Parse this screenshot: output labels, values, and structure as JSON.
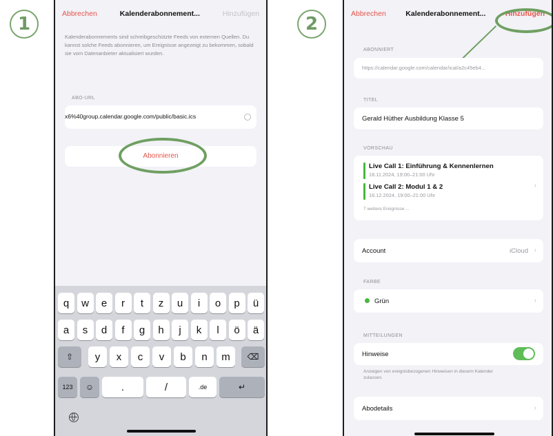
{
  "steps": {
    "one": "1",
    "two": "2"
  },
  "colors": {
    "accent": "#e5544b",
    "annotation": "#6f9f61",
    "toggle_on": "#5fbd58",
    "calendar_green": "#46b83f"
  },
  "screen1": {
    "nav": {
      "cancel": "Abbrechen",
      "title": "Kalenderabonnement...",
      "add": "Hinzufügen"
    },
    "description": "Kalenderabonnements sind schreibgeschützte Feeds von externen Quellen. Du kannst solche Feeds abonnieren, um Ereignisse angezeigt zu bekommen, sobald sie vom Datenanbieter aktualisiert wurden.",
    "url_label": "ABO-URL",
    "url_value": "x6%40group.calendar.google.com/public/basic.ics",
    "clear_icon": "clear-circle-icon",
    "subscribe_button": "Abonnieren",
    "keyboard": {
      "row1": [
        "q",
        "w",
        "e",
        "r",
        "t",
        "z",
        "u",
        "i",
        "o",
        "p",
        "ü"
      ],
      "row2": [
        "a",
        "s",
        "d",
        "f",
        "g",
        "h",
        "j",
        "k",
        "l",
        "ö",
        "ä"
      ],
      "row3": [
        "y",
        "x",
        "c",
        "v",
        "b",
        "n",
        "m"
      ],
      "numbers_key": "123",
      "dot_key": ".",
      "slash_key": "/",
      "de_key": ".de",
      "shift_icon": "shift-icon",
      "delete_icon": "backspace-icon",
      "emoji_icon": "emoji-icon",
      "return_icon": "return-icon",
      "globe_icon": "globe-icon"
    }
  },
  "screen2": {
    "nav": {
      "cancel": "Abbrechen",
      "title": "Kalenderabonnement...",
      "add": "Hinzufügen"
    },
    "subscribed_label": "ABONNIERT",
    "subscribed_url": "https://calendar.google.com/calendar/ical/a2c45eb4...",
    "title_label": "TITEL",
    "title_value": "Gerald Hüther Ausbildung Klasse 5",
    "preview_label": "VORSCHAU",
    "events": [
      {
        "title": "Live Call 1: Einführung & Kennenlernen",
        "time": "18.11.2024, 19:00–21:00 Uhr"
      },
      {
        "title": "Live Call 2: Modul 1 & 2",
        "time": "16.12.2024, 19:00–21:00 Uhr"
      }
    ],
    "more_events": "7 weitere Ereignisse ...",
    "account_label": "Account",
    "account_value": "iCloud",
    "color_label": "FARBE",
    "color_value": "Grün",
    "notifications_label": "MITTEILUNGEN",
    "alerts_label": "Hinweise",
    "alerts_on": true,
    "alerts_footer": "Anzeigen von ereignisbezogenen Hinweisen in diesem Kalender zulassen.",
    "details_label": "Abodetails"
  }
}
